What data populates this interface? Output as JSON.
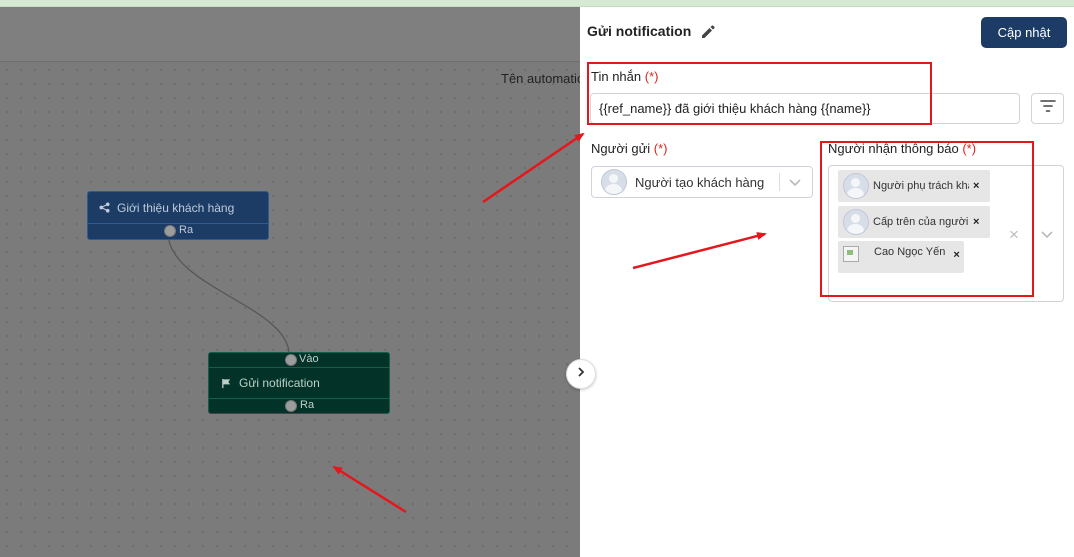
{
  "canvas": {
    "automation_title": "Tên automatio",
    "trigger_node": {
      "label": "Giới thiệu khách hàng",
      "out_port": "Ra"
    },
    "action_node": {
      "label": "Gửi notification",
      "in_port": "Vào",
      "out_port": "Ra"
    }
  },
  "panel": {
    "title": "Gửi notification",
    "save_label": "Cập nhật",
    "message": {
      "label": "Tin nhắn",
      "required_mark": "(*)",
      "value": "{{ref_name}} đã giới thiệu khách hàng {{name}}"
    },
    "sender": {
      "label": "Người gửi",
      "required_mark": "(*)",
      "value": "Người tạo khách hàng"
    },
    "recipients": {
      "label": "Người nhận thông báo",
      "required_mark": "(*)",
      "chips": [
        {
          "text": "Người phụ trách khá",
          "remove": "×"
        },
        {
          "text": "Cấp trên của người p",
          "remove": "×"
        },
        {
          "text": "Cao Ngọc Yến",
          "remove": "×"
        }
      ],
      "clear": "×"
    }
  },
  "colors": {
    "primary": "#1c3c66",
    "required": "#d9261c",
    "highlight": "#e5161c"
  },
  "icons": [
    "pencil-icon",
    "filter-icon",
    "chevron-right-icon",
    "chevron-down-icon",
    "share-icon",
    "flag-icon",
    "close-icon"
  ]
}
